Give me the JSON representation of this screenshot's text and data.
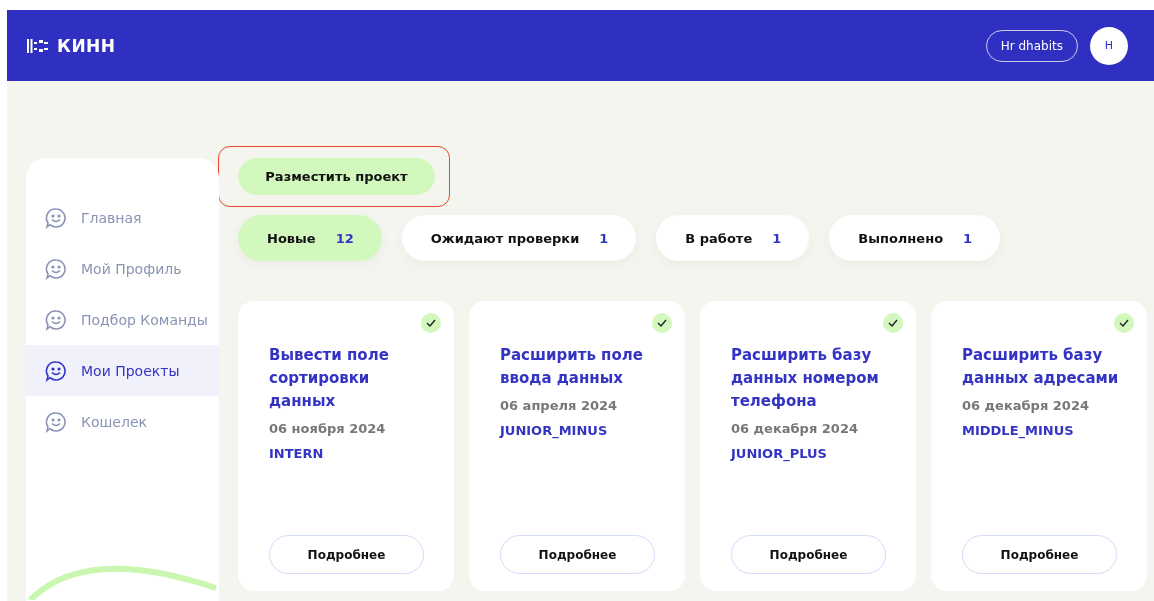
{
  "header": {
    "logo": "КИНН",
    "user_button": "Hr dhabits",
    "avatar": "H"
  },
  "sidebar": {
    "items": [
      {
        "label": "Главная",
        "selected": false
      },
      {
        "label": "Мой Профиль",
        "selected": false
      },
      {
        "label": "Подбор Команды",
        "selected": false
      },
      {
        "label": "Мои Проекты",
        "selected": true
      },
      {
        "label": "Кошелек",
        "selected": false
      }
    ]
  },
  "place_button": {
    "label": "Разместить проект",
    "highlighted": true
  },
  "filters": [
    {
      "label": "Новые",
      "count": "12",
      "selected": true
    },
    {
      "label": "Ожидают проверки",
      "count": "1",
      "selected": false
    },
    {
      "label": "В работе",
      "count": "1",
      "selected": false
    },
    {
      "label": "Выполнено",
      "count": "1",
      "selected": false
    }
  ],
  "cards": [
    {
      "title": "Вывести поле сортировки данных",
      "date": "06 ноября 2024",
      "level": "INTERN",
      "checked": true,
      "button": "Подробнее"
    },
    {
      "title": "Расширить поле ввода данных",
      "date": "06 апреля 2024",
      "level": "JUNIOR_MINUS",
      "checked": true,
      "button": "Подробнее"
    },
    {
      "title": "Расширить базу данных номером телефона",
      "date": "06 декабря 2024",
      "level": "JUNIOR_PLUS",
      "checked": true,
      "button": "Подробнее"
    },
    {
      "title": "Расширить базу данных адресами",
      "date": "06 декабря 2024",
      "level": "MIDDLE_MINUS",
      "checked": true,
      "button": "Подробнее"
    }
  ]
}
